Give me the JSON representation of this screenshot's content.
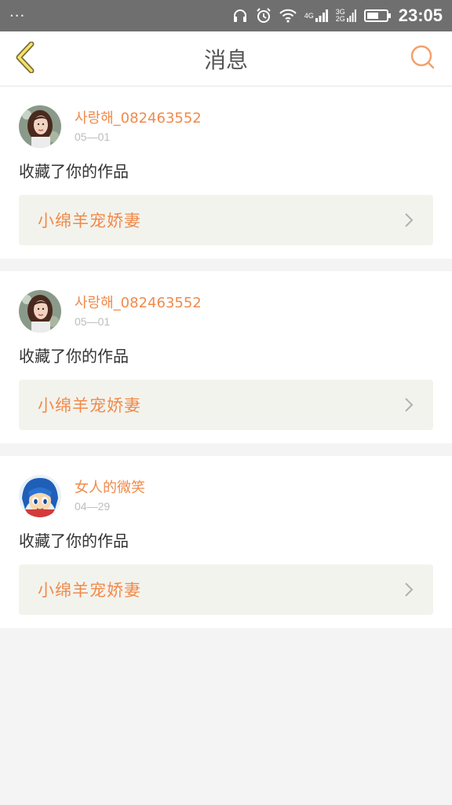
{
  "status_bar": {
    "left_text": "···",
    "network_top": "4G",
    "net2_top": "3G",
    "net2_bottom": "2G",
    "time": "23:05"
  },
  "header": {
    "title": "消息",
    "back_icon": "chevron-left-icon",
    "search_icon": "search-icon"
  },
  "accent_color": "#f08a4b",
  "messages": [
    {
      "username": "사랑해_082463552",
      "date": "05—01",
      "action": "收藏了你的作品",
      "work_title": "小绵羊宠娇妻",
      "avatar": "girl-photo"
    },
    {
      "username": "사랑해_082463552",
      "date": "05—01",
      "action": "收藏了你的作品",
      "work_title": "小绵羊宠娇妻",
      "avatar": "girl-photo"
    },
    {
      "username": "女人的微笑",
      "date": "04—29",
      "action": "收藏了你的作品",
      "work_title": "小绵羊宠娇妻",
      "avatar": "cartoon-blue-hair"
    }
  ]
}
